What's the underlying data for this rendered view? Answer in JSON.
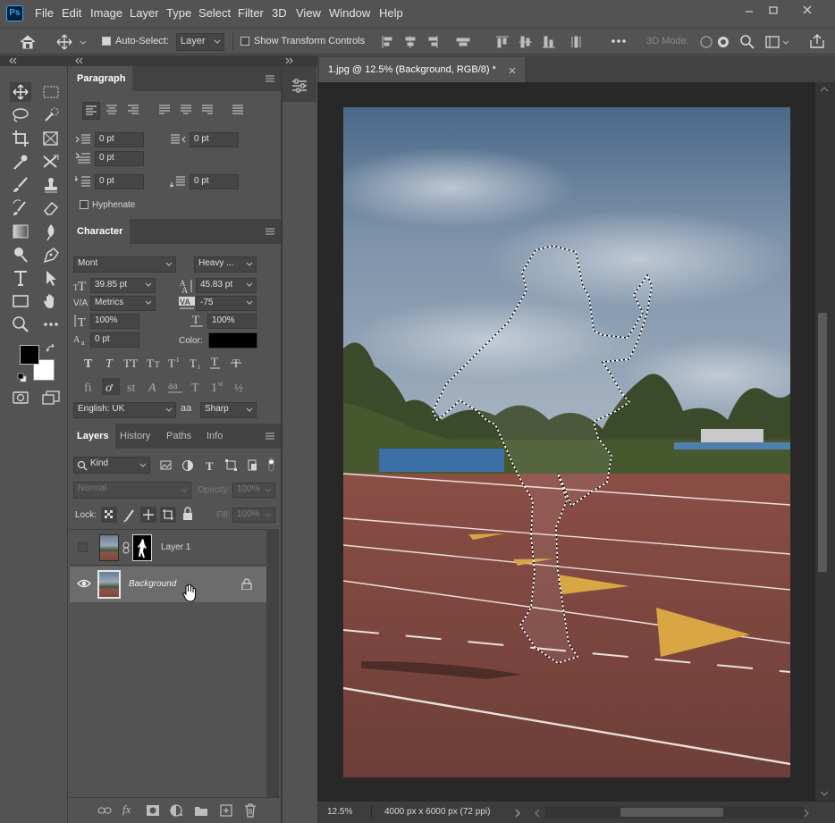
{
  "app": {
    "logo": "Ps"
  },
  "menu": [
    "File",
    "Edit",
    "Image",
    "Layer",
    "Type",
    "Select",
    "Filter",
    "3D",
    "View",
    "Window",
    "Help"
  ],
  "options": {
    "auto_select_label": "Auto-Select:",
    "auto_select_value": "Layer",
    "show_transform_label": "Show Transform Controls",
    "three_d_mode_label": "3D Mode:"
  },
  "document": {
    "tab_title": "1.jpg @ 12.5% (Background, RGB/8) *",
    "zoom": "12.5%",
    "dimensions": "4000 px x 6000 px (72 ppi)"
  },
  "paragraph_panel": {
    "tab": "Paragraph",
    "indent_left": "0 pt",
    "indent_right": "0 pt",
    "indent_first": "0 pt",
    "space_before": "0 pt",
    "space_after": "0 pt",
    "hyphenate_label": "Hyphenate"
  },
  "character_panel": {
    "tab": "Character",
    "font_family": "Mont",
    "font_style": "Heavy ...",
    "font_size": "39.85 pt",
    "leading": "45.83 pt",
    "kerning": "Metrics",
    "tracking": "-75",
    "vscale": "100%",
    "hscale": "100%",
    "baseline": "0 pt",
    "color_label": "Color:",
    "language": "English: UK",
    "aa_label": "aa",
    "antialias": "Sharp",
    "type_buttons": [
      "T",
      "T",
      "TT",
      "Tт",
      "T¹",
      "T₁",
      "T",
      "T"
    ],
    "opentype_buttons": [
      "fi",
      "ơ",
      "st",
      "A",
      "aa",
      "T",
      "1st",
      "½"
    ]
  },
  "layers_panel": {
    "tabs": [
      "Layers",
      "History",
      "Paths",
      "Info"
    ],
    "filter_kind": "Kind",
    "blend_mode": "Normal",
    "opacity_label": "Opacity:",
    "opacity_value": "100%",
    "lock_label": "Lock:",
    "fill_label": "Fill:",
    "fill_value": "100%",
    "layers": [
      {
        "name": "Layer 1",
        "visible": false,
        "selected": false
      },
      {
        "name": "Background",
        "visible": true,
        "selected": true
      }
    ]
  },
  "colors": {
    "foreground": "#000000",
    "background": "#ffffff",
    "text_color": "#000000"
  }
}
